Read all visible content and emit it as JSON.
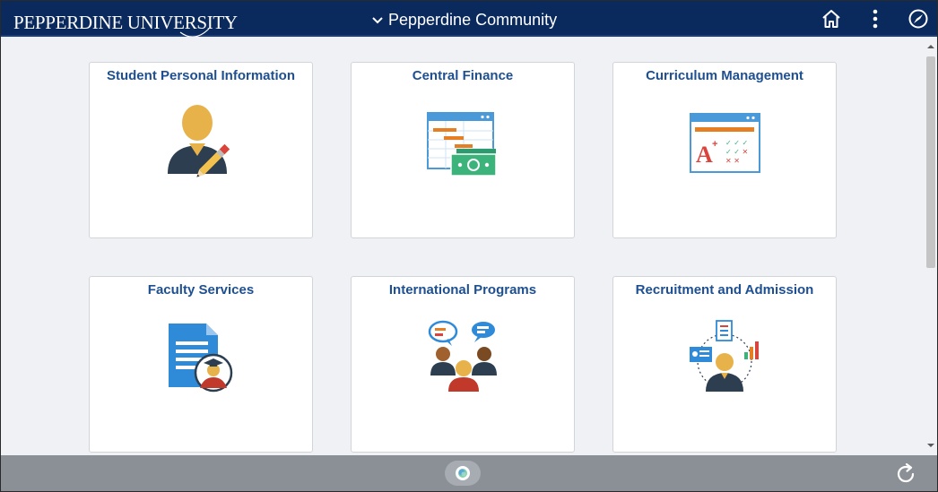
{
  "header": {
    "logo_text": "PEPPERDINE UNIVERSITY",
    "nav_title": "Pepperdine Community",
    "icons": [
      "chevron-down-icon",
      "home-icon",
      "more-vertical-icon",
      "navbar-compass-icon"
    ]
  },
  "tiles": [
    {
      "title": "Student Personal Information",
      "icon": "student-person-pencil-icon"
    },
    {
      "title": "Central Finance",
      "icon": "finance-spreadsheet-money-icon"
    },
    {
      "title": "Curriculum Management",
      "icon": "grade-chart-icon"
    },
    {
      "title": "Faculty Services",
      "icon": "document-graduate-icon"
    },
    {
      "title": "International Programs",
      "icon": "people-speech-bubbles-icon"
    },
    {
      "title": "Recruitment and Admission",
      "icon": "recruitment-person-icon"
    }
  ],
  "footer": {
    "icons": [
      "page-indicator-icon",
      "refresh-icon"
    ]
  },
  "colors": {
    "header_bg": "#0a2a5e",
    "tile_title": "#1d4f91",
    "page_bg": "#f0f1f4",
    "footer_bg": "#8b8f96"
  }
}
